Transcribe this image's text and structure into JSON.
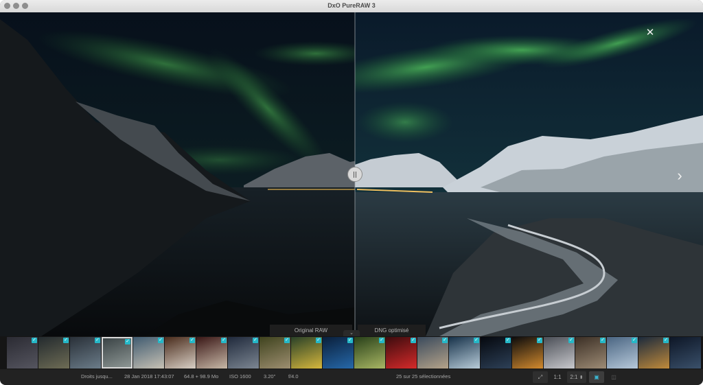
{
  "app": {
    "title": "DxO PureRAW 3"
  },
  "viewer": {
    "close_icon": "✕",
    "next_icon": "›",
    "left_label": "Original RAW",
    "right_label": "DNG optimisé",
    "collapse_icon": "⌄"
  },
  "filmstrip": {
    "thumbnails": [
      {
        "colors": [
          "#2b2b33",
          "#55555f"
        ],
        "checked": true,
        "selected": false
      },
      {
        "colors": [
          "#232a2e",
          "#6e6c55"
        ],
        "checked": true,
        "selected": false
      },
      {
        "colors": [
          "#293038",
          "#6b7c89"
        ],
        "checked": true,
        "selected": false
      },
      {
        "colors": [
          "#3b4446",
          "#8d9694"
        ],
        "checked": true,
        "selected": true
      },
      {
        "colors": [
          "#405b70",
          "#c7c1b4"
        ],
        "checked": true,
        "selected": false
      },
      {
        "colors": [
          "#4a2c1c",
          "#d8cfc5"
        ],
        "checked": true,
        "selected": false
      },
      {
        "colors": [
          "#3a1716",
          "#c7b8a7"
        ],
        "checked": true,
        "selected": false
      },
      {
        "colors": [
          "#202a3c",
          "#7c8692"
        ],
        "checked": true,
        "selected": false
      },
      {
        "colors": [
          "#3f431e",
          "#9d8e70"
        ],
        "checked": true,
        "selected": false
      },
      {
        "colors": [
          "#294128",
          "#d6b73d"
        ],
        "checked": true,
        "selected": false
      },
      {
        "colors": [
          "#0a1f3b",
          "#2668a9"
        ],
        "checked": true,
        "selected": false
      },
      {
        "colors": [
          "#284019",
          "#a9b764"
        ],
        "checked": true,
        "selected": false
      },
      {
        "colors": [
          "#3d0c0e",
          "#d52a2a"
        ],
        "checked": true,
        "selected": false
      },
      {
        "colors": [
          "#3a4a5c",
          "#b5a38a"
        ],
        "checked": true,
        "selected": false
      },
      {
        "colors": [
          "#17324a",
          "#b8ccd9"
        ],
        "checked": true,
        "selected": false
      },
      {
        "colors": [
          "#05080e",
          "#2d4057"
        ],
        "checked": true,
        "selected": false
      },
      {
        "colors": [
          "#0b0b0c",
          "#d28a2e"
        ],
        "checked": true,
        "selected": false
      },
      {
        "colors": [
          "#4b4f57",
          "#c8c8cc"
        ],
        "checked": true,
        "selected": false
      },
      {
        "colors": [
          "#3b2f25",
          "#9d8b75"
        ],
        "checked": true,
        "selected": false
      },
      {
        "colors": [
          "#4a6582",
          "#b7c9da"
        ],
        "checked": true,
        "selected": false
      },
      {
        "colors": [
          "#1c2a3c",
          "#c08a3b"
        ],
        "checked": true,
        "selected": false
      },
      {
        "colors": [
          "#0d1626",
          "#3a506a"
        ],
        "checked": false,
        "selected": false
      }
    ]
  },
  "status": {
    "copyright": "Droits jusqu...",
    "date": "28 Jan 2018 17:43:07",
    "size": "64.8 + 98.9 Mo",
    "iso": "ISO 1600",
    "shutter": "3.20\"",
    "aperture": "f/4.0",
    "selection": "25 sur 25 sélectionnées",
    "zoom_fit_icon": "⤢",
    "zoom_1_1": "1:1",
    "zoom_2_1": "2:1",
    "zoom_stepper_icon": "⬍",
    "view_single_icon": "▣",
    "view_compare_icon": "◫"
  }
}
